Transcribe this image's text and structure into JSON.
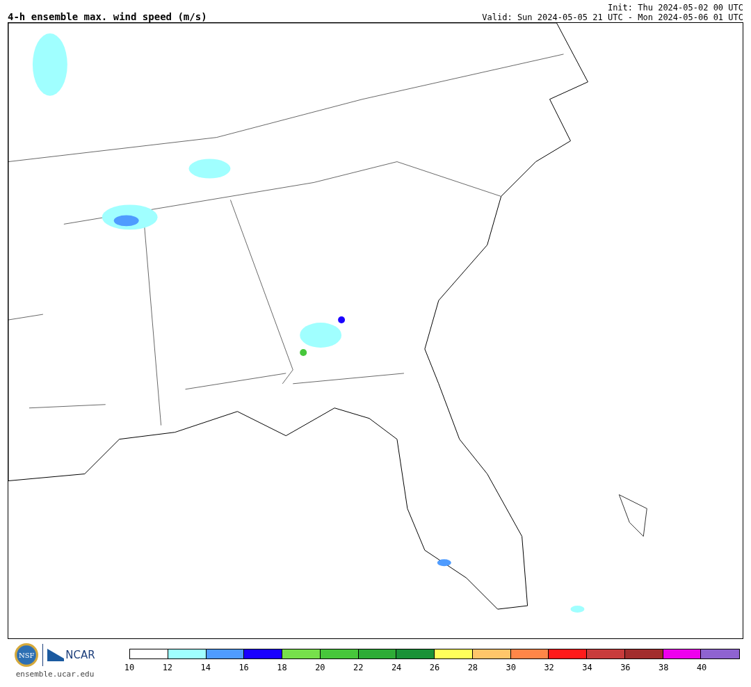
{
  "title": "4-h ensemble max. wind speed (m/s)",
  "init": "Init: Thu 2024-05-02 00 UTC",
  "valid": "Valid: Sun 2024-05-05 21 UTC - Mon 2024-05-06 01 UTC",
  "logos": {
    "nsf": "NSF",
    "ncar": "NCAR"
  },
  "site": "ensemble.ucar.edu",
  "colorbar": {
    "bins": [
      {
        "color": "#ffffff"
      },
      {
        "color": "#a0ffff"
      },
      {
        "color": "#4f9cff"
      },
      {
        "color": "#1a00ff"
      },
      {
        "color": "#77e04b"
      },
      {
        "color": "#47c73b"
      },
      {
        "color": "#2eac36"
      },
      {
        "color": "#1a9237"
      },
      {
        "color": "#ffff5a"
      },
      {
        "color": "#ffc66a"
      },
      {
        "color": "#ff8648"
      },
      {
        "color": "#ff1b1b"
      },
      {
        "color": "#c83c3c"
      },
      {
        "color": "#a22d2d"
      },
      {
        "color": "#ee00ee"
      },
      {
        "color": "#8f63d1"
      }
    ],
    "ticks": [
      "10",
      "12",
      "14",
      "16",
      "18",
      "20",
      "22",
      "24",
      "26",
      "28",
      "30",
      "32",
      "34",
      "36",
      "38",
      "40"
    ]
  }
}
